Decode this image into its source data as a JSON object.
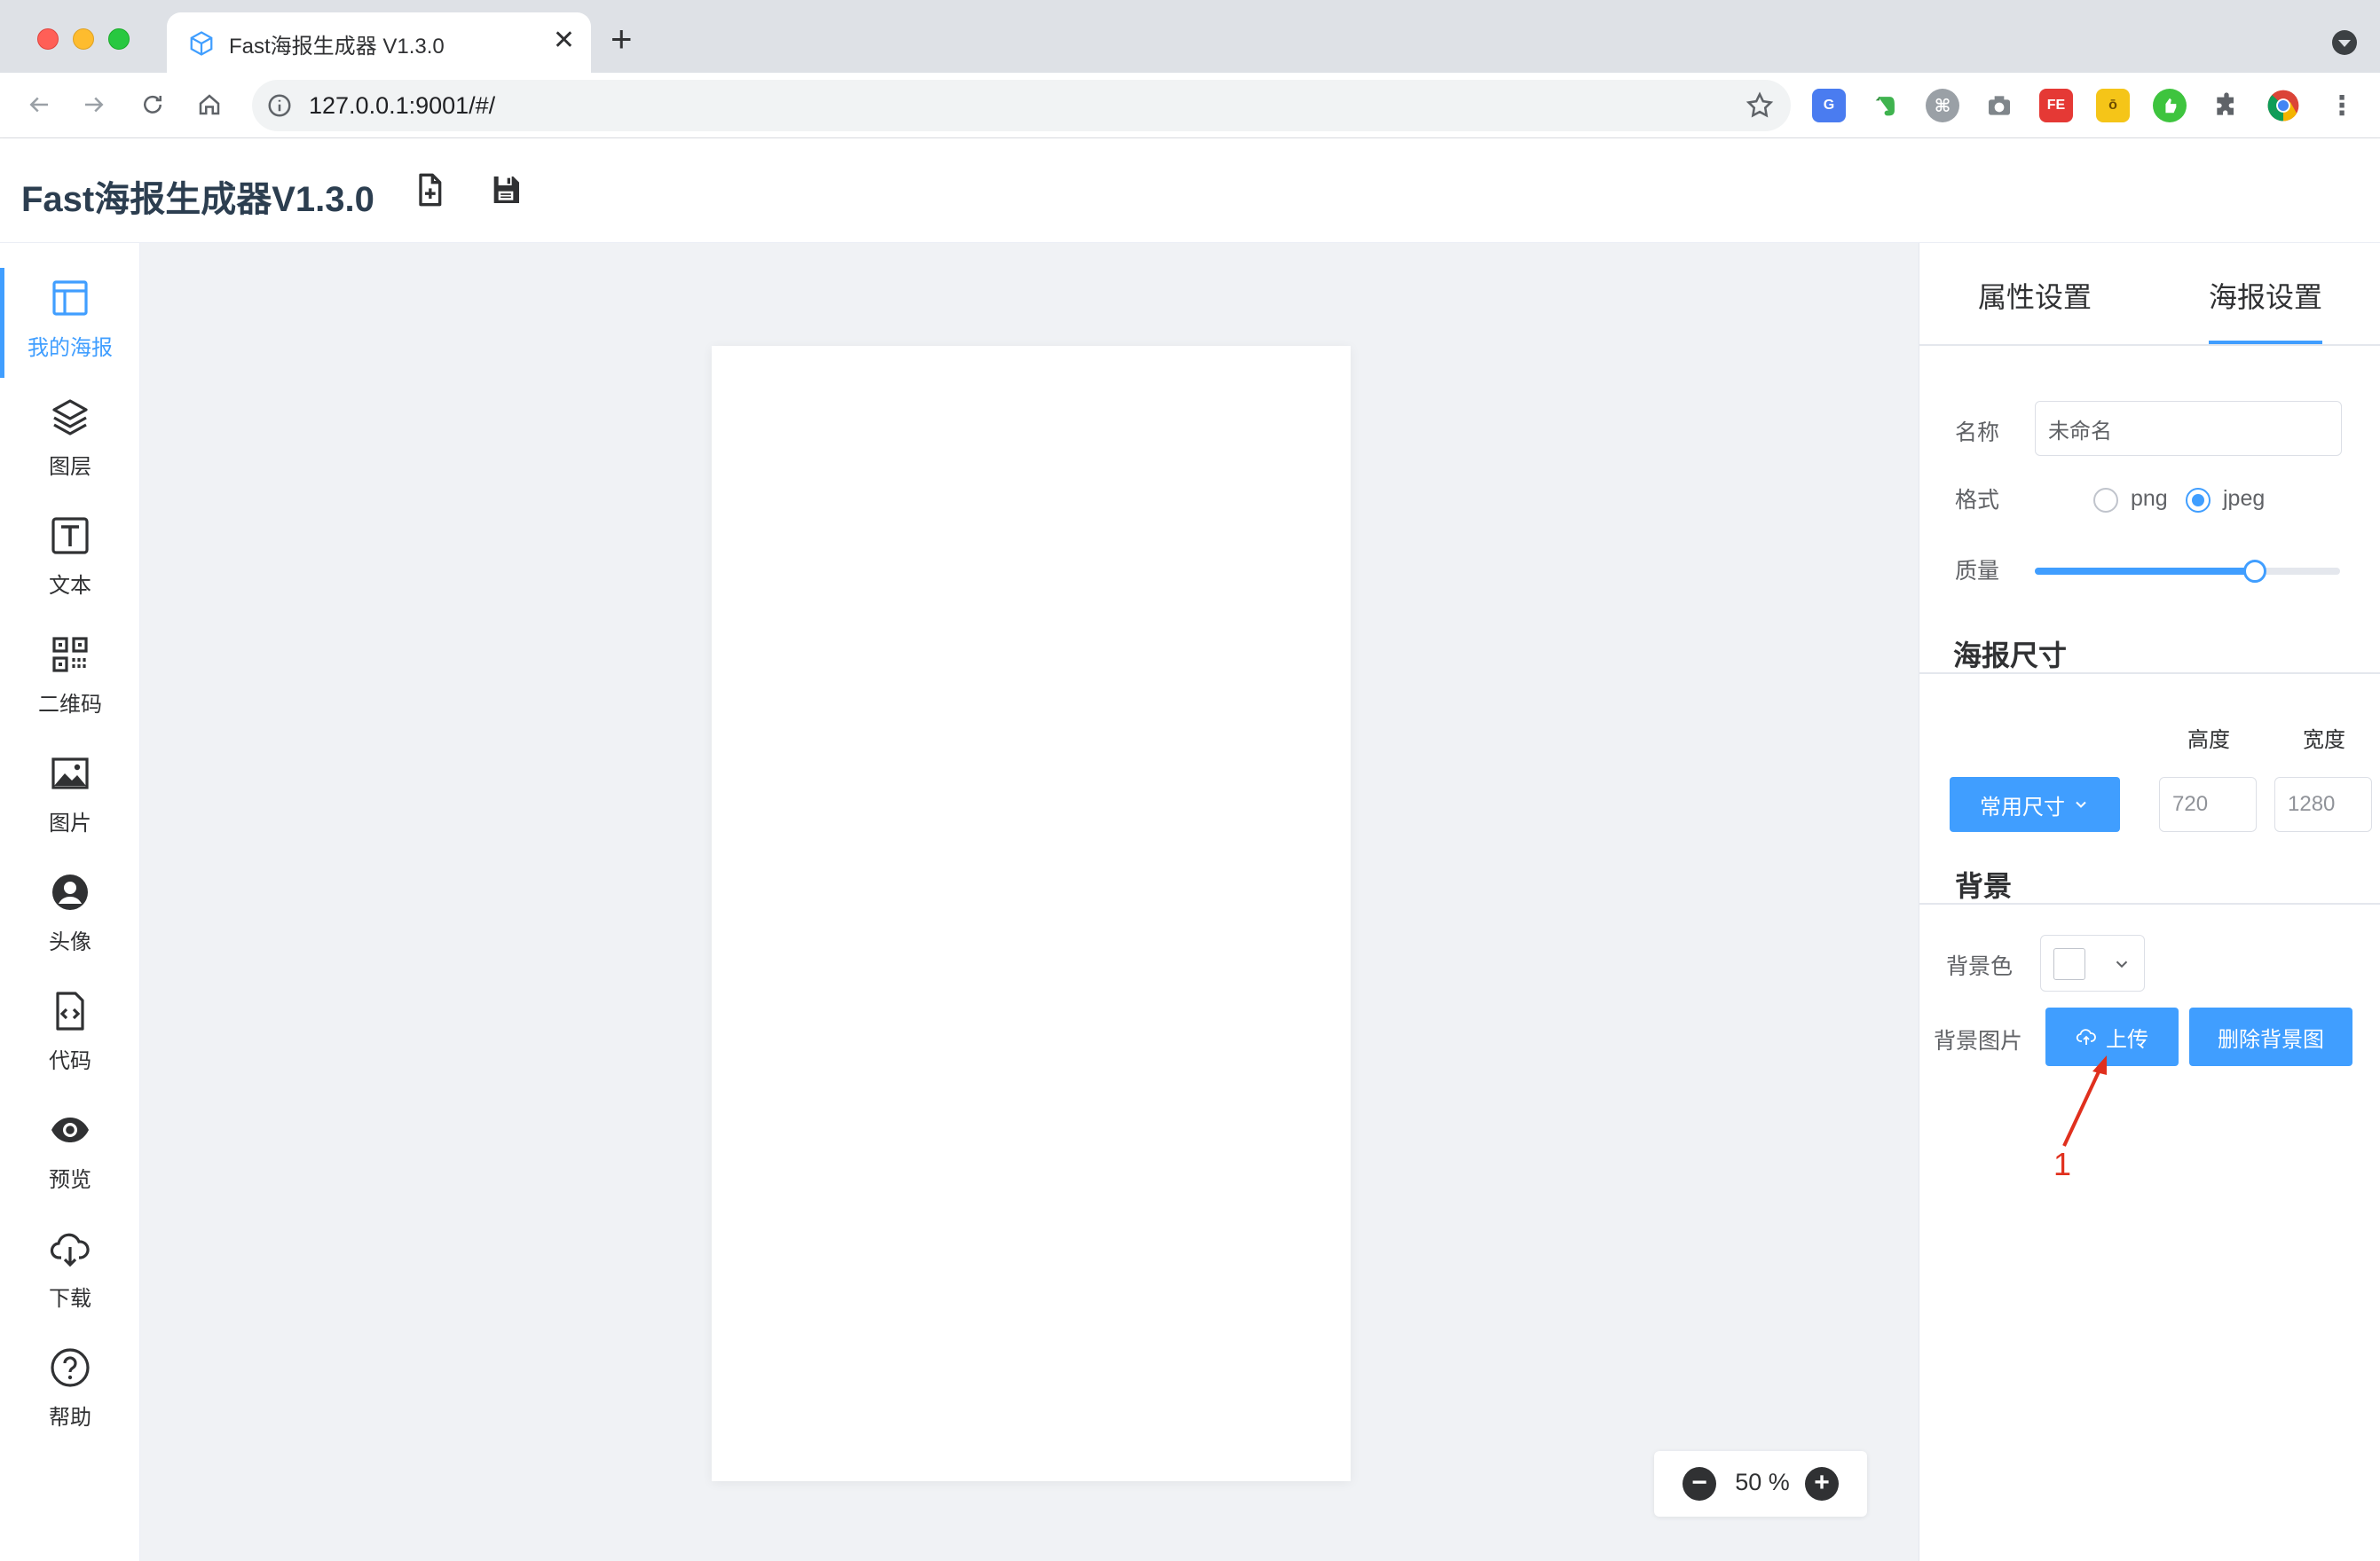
{
  "browser": {
    "tab_title": "Fast海报生成器 V1.3.0",
    "url": "127.0.0.1:9001/#/",
    "extensions": [
      "translate-icon",
      "evernote-icon",
      "cmd-icon",
      "camera-icon",
      "fe-icon",
      "mask-icon",
      "green-ext-icon",
      "puzzle-icon",
      "chrome-icon",
      "more-icon"
    ]
  },
  "app": {
    "title": "Fast海报生成器V1.3.0"
  },
  "sidebar": {
    "items": [
      {
        "label": "我的海报",
        "icon": "layout-icon",
        "active": true
      },
      {
        "label": "图层",
        "icon": "layers-icon"
      },
      {
        "label": "文本",
        "icon": "text-icon"
      },
      {
        "label": "二维码",
        "icon": "qrcode-icon"
      },
      {
        "label": "图片",
        "icon": "image-icon"
      },
      {
        "label": "头像",
        "icon": "avatar-icon"
      },
      {
        "label": "代码",
        "icon": "code-icon"
      },
      {
        "label": "预览",
        "icon": "eye-icon"
      },
      {
        "label": "下载",
        "icon": "cloud-download-icon"
      },
      {
        "label": "帮助",
        "icon": "help-icon"
      }
    ]
  },
  "canvas": {
    "zoom": "50 %"
  },
  "panel": {
    "tabs": [
      "属性设置",
      "海报设置"
    ],
    "active_tab": "海报设置",
    "name_label": "名称",
    "name_value": "未命名",
    "format_label": "格式",
    "format_options": [
      "png",
      "jpeg"
    ],
    "format_selected": "jpeg",
    "quality_label": "质量",
    "quality_value": 0.72,
    "size_section": "海报尺寸",
    "height_label": "高度",
    "width_label": "宽度",
    "preset_button": "常用尺寸",
    "height_value": "720",
    "width_value": "1280",
    "bg_section": "背景",
    "bg_color_label": "背景色",
    "bg_color": "#ffffff",
    "bg_image_label": "背景图片",
    "upload_button": "上传",
    "delete_bg_button": "删除背景图"
  },
  "annotation": {
    "number": "1",
    "color": "#e0301e"
  },
  "colors": {
    "accent": "#409eff",
    "canvas_bg": "#f0f2f5"
  }
}
